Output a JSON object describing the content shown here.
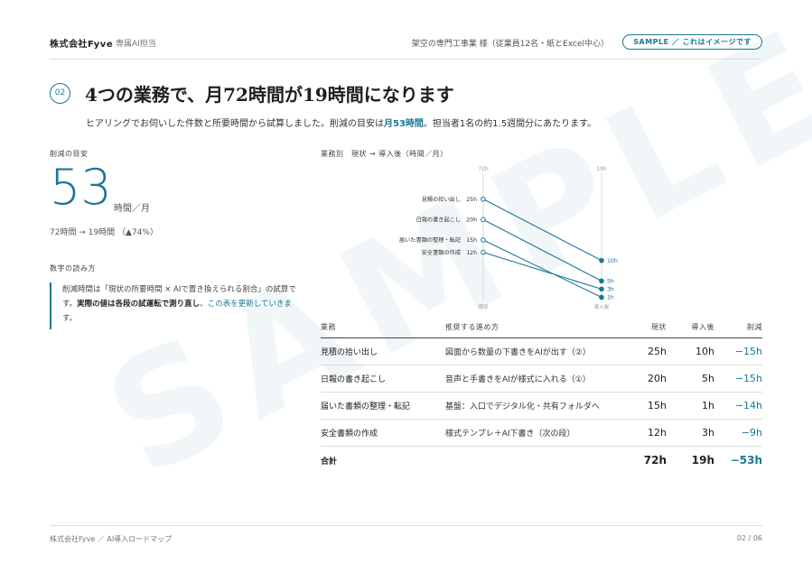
{
  "header": {
    "brand": "株式会社Fyve",
    "brand_sub": "専属AI担当",
    "client": "架空の専門工事業 様（従業員12名・紙とExcel中心）",
    "sample_badge": "SAMPLE ／ これはイメージです"
  },
  "watermark": "SAMPLE",
  "section": {
    "number": "02",
    "title": "4つの業務で、月72時間が19時間になります",
    "lead_pre": "ヒアリングでお伺いした件数と所要時間から試算しました。削減の目安は",
    "lead_highlight": "月53時間",
    "lead_post": "。担当者1名の約1.5週間分にあたります。"
  },
  "summary": {
    "label": "削減の目安",
    "value": "53",
    "unit": "時間／月",
    "detail": "72時間 → 19時間 （▲74%）"
  },
  "reading": {
    "label": "数字の読み方",
    "line1": "削減時間は「現状の所要時間 × AIで置き換えられる割合」の試算で",
    "line2_pre": "す。",
    "line2_bold": "実際の値は各段の試運転で測り直し",
    "line2_mid": "、",
    "line2_teal": "この表を更新していきま",
    "line3": "す。"
  },
  "chart": {
    "label": "業務別　現状 → 導入後（時間／月）"
  },
  "chart_data": {
    "type": "line",
    "subtype": "slope",
    "top_labels": [
      "72h",
      "19h"
    ],
    "bottom_labels": [
      "現状",
      "導入後"
    ],
    "series": [
      {
        "name": "見積の拾い出し",
        "before": 25,
        "after": 10,
        "before_label": "25h",
        "after_label": "10h"
      },
      {
        "name": "日報の書き起こし",
        "before": 20,
        "after": 5,
        "before_label": "20h",
        "after_label": "5h"
      },
      {
        "name": "届いた書類の整理・転記",
        "before": 15,
        "after": 1,
        "before_label": "15h",
        "after_label": "1h"
      },
      {
        "name": "安全書類の作成",
        "before": 12,
        "after": 3,
        "before_label": "12h",
        "after_label": "3h"
      }
    ],
    "color": "#1a7797"
  },
  "table": {
    "headers": [
      "業務",
      "推奨する進め方",
      "現状",
      "導入後",
      "削減"
    ],
    "rows": [
      {
        "task": "見積の拾い出し",
        "method": "図面から数量の下書きをAIが出す（②）",
        "before": "25h",
        "after": "10h",
        "cut": "−15h"
      },
      {
        "task": "日報の書き起こし",
        "method": "音声と手書きをAIが様式に入れる（①）",
        "before": "20h",
        "after": "5h",
        "cut": "−15h"
      },
      {
        "task": "届いた書類の整理・転記",
        "method": "基盤：入口でデジタル化・共有フォルダへ",
        "before": "15h",
        "after": "1h",
        "cut": "−14h"
      },
      {
        "task": "安全書類の作成",
        "method": "様式テンプレ＋AI下書き（次の段）",
        "before": "12h",
        "after": "3h",
        "cut": "−9h"
      }
    ],
    "total": {
      "label": "合計",
      "before": "72h",
      "after": "19h",
      "cut": "−53h"
    }
  },
  "footer": {
    "left": "株式会社Fyve ／ AI導入ロードマップ",
    "page": "02 / 06"
  },
  "colors": {
    "accent": "#1a7797",
    "text": "#2b2b2b",
    "rule": "#dcdcdc"
  }
}
